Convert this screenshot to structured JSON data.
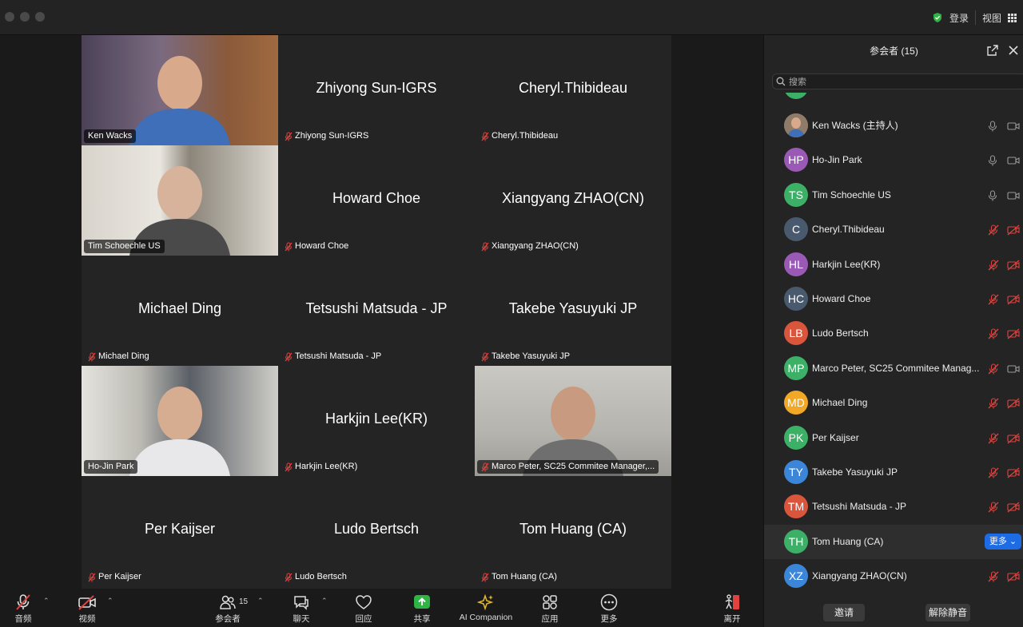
{
  "titlebar": {
    "login": "登录",
    "view": "视图"
  },
  "tiles": [
    {
      "name": "Ken Wacks",
      "video": true,
      "active": true,
      "muted": false
    },
    {
      "name": "Zhiyong Sun-IGRS",
      "video": false,
      "muted": true
    },
    {
      "name": "Cheryl.Thibideau",
      "video": false,
      "muted": true
    },
    {
      "name": "Tim Schoechle US",
      "video": true,
      "muted": false
    },
    {
      "name": "Howard Choe",
      "video": false,
      "muted": true
    },
    {
      "name": "Xiangyang ZHAO(CN)",
      "video": false,
      "muted": true
    },
    {
      "name": "Michael Ding",
      "video": false,
      "muted": true
    },
    {
      "name": "Tetsushi Matsuda - JP",
      "video": false,
      "muted": true
    },
    {
      "name": "Takebe Yasuyuki JP",
      "video": false,
      "muted": true
    },
    {
      "name": "Ho-Jin Park",
      "video": true,
      "muted": false
    },
    {
      "name": "Harkjin Lee(KR)",
      "video": false,
      "muted": true
    },
    {
      "name": "Marco Peter, SC25 Commitee Manager,...",
      "video": true,
      "muted": true
    },
    {
      "name": "Per Kaijser",
      "video": false,
      "muted": true
    },
    {
      "name": "Ludo Bertsch",
      "video": false,
      "muted": true
    },
    {
      "name": "Tom Huang (CA)",
      "video": false,
      "muted": true
    }
  ],
  "toolbar": {
    "audio": "音频",
    "video": "视频",
    "participants": "参会者",
    "participants_count": "15",
    "chat": "聊天",
    "react": "回应",
    "share": "共享",
    "ai": "AI Companion",
    "apps": "应用",
    "more": "更多",
    "leave": "离开"
  },
  "panel": {
    "title": "参会者 (15)",
    "search_placeholder": "搜索",
    "more_button": "更多",
    "invite": "邀请",
    "unmute": "解除静音",
    "participants": [
      {
        "initials": "",
        "name": "Ken Wacks (主持人)",
        "color": "#8a7a6a",
        "photo": true,
        "mic": "on",
        "cam": "on"
      },
      {
        "initials": "HP",
        "name": "Ho-Jin Park",
        "color": "#9b59b6",
        "mic": "on",
        "cam": "on"
      },
      {
        "initials": "TS",
        "name": "Tim Schoechle US",
        "color": "#3db067",
        "mic": "on",
        "cam": "on"
      },
      {
        "initials": "C",
        "name": "Cheryl.Thibideau",
        "color": "#4a5a6e",
        "mic": "off",
        "cam": "off"
      },
      {
        "initials": "HL",
        "name": "Harkjin Lee(KR)",
        "color": "#9b59b6",
        "mic": "off",
        "cam": "off"
      },
      {
        "initials": "HC",
        "name": "Howard Choe",
        "color": "#4a5a6e",
        "mic": "off",
        "cam": "off"
      },
      {
        "initials": "LB",
        "name": "Ludo Bertsch",
        "color": "#d9553b",
        "mic": "off",
        "cam": "off"
      },
      {
        "initials": "MP",
        "name": "Marco Peter, SC25 Commitee Manag...",
        "color": "#3db067",
        "mic": "off",
        "cam": "on"
      },
      {
        "initials": "MD",
        "name": "Michael Ding",
        "color": "#f0a826",
        "mic": "off",
        "cam": "off"
      },
      {
        "initials": "PK",
        "name": "Per Kaijser",
        "color": "#3db067",
        "mic": "off",
        "cam": "off"
      },
      {
        "initials": "TY",
        "name": "Takebe Yasuyuki JP",
        "color": "#3b86d9",
        "mic": "off",
        "cam": "off"
      },
      {
        "initials": "TM",
        "name": "Tetsushi Matsuda - JP",
        "color": "#d9553b",
        "mic": "off",
        "cam": "off"
      },
      {
        "initials": "TH",
        "name": "Tom Huang (CA)",
        "color": "#3db067",
        "mic": "more",
        "cam": "",
        "highlight": true
      },
      {
        "initials": "XZ",
        "name": "Xiangyang ZHAO(CN)",
        "color": "#3b86d9",
        "mic": "off",
        "cam": "off"
      }
    ]
  }
}
